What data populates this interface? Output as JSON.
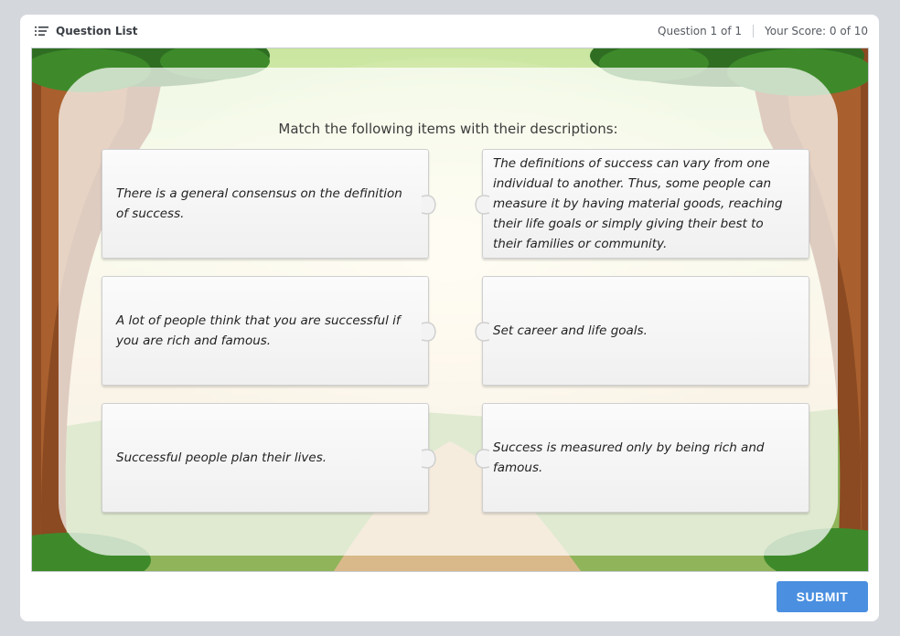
{
  "header": {
    "question_list_label": "Question List",
    "question_counter": "Question 1 of 1",
    "score": "Your Score: 0 of 10"
  },
  "activity": {
    "instruction": "Match the following items with their descriptions:",
    "left_items": [
      "There is a general consensus on the definition of success.",
      "A lot of people think that you are successful if you are rich and famous.",
      "Successful people plan their lives."
    ],
    "right_items": [
      "The definitions of success can vary from one individual to another. Thus,  some people can measure it by having material goods, reaching their life goals or simply giving their best to their families or community.",
      "Set career and life goals.",
      "Success is measured only by being rich and famous."
    ]
  },
  "footer": {
    "submit_label": "SUBMIT"
  },
  "colors": {
    "submit_button": "#4a8fe0",
    "page_background": "#d4d7db"
  },
  "icons": {
    "question_list": "list-icon",
    "connector": "puzzle-tab-icon"
  }
}
